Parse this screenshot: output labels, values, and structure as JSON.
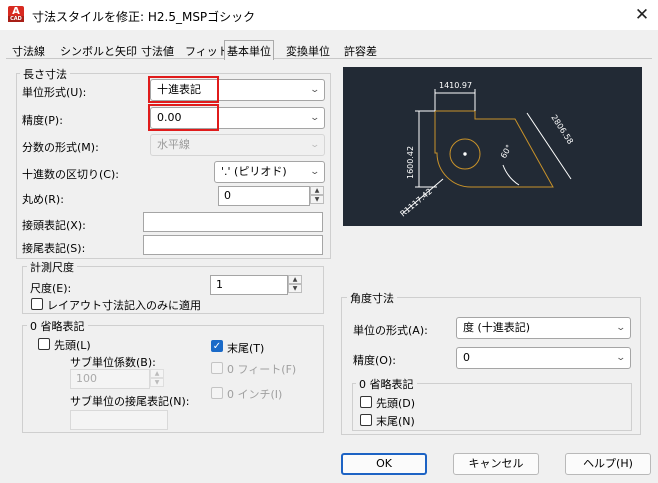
{
  "window": {
    "title": "寸法スタイルを修正: H2.5_MSPゴシック",
    "app_icon_letter": "A",
    "app_icon_sub": "CAD"
  },
  "tabs": [
    "寸法線",
    "シンボルと矢印",
    "寸法値",
    "フィット",
    "基本単位",
    "変換単位",
    "許容差"
  ],
  "active_tab": "基本単位",
  "linear": {
    "group_title": "長さ寸法",
    "unit_format_label": "単位形式(U):",
    "unit_format_value": "十進表記",
    "precision_label": "精度(P):",
    "precision_value": "0.00",
    "fraction_format_label": "分数の形式(M):",
    "fraction_format_value": "水平線",
    "decimal_separator_label": "十進数の区切り(C):",
    "decimal_separator_value": "'.' (ピリオド)",
    "round_off_label": "丸め(R):",
    "round_off_value": "0",
    "prefix_label": "接頭表記(X):",
    "prefix_value": "",
    "suffix_label": "接尾表記(S):",
    "suffix_value": ""
  },
  "scale": {
    "group_title": "計測尺度",
    "factor_label": "尺度(E):",
    "factor_value": "1",
    "layout_only_label": "レイアウト寸法記入のみに適用",
    "layout_only_checked": false
  },
  "zero_suppression_linear": {
    "group_title": "0 省略表記",
    "leading_label": "先頭(L)",
    "leading_checked": false,
    "trailing_label": "末尾(T)",
    "trailing_checked": true,
    "sub_unit_factor_label": "サブ単位係数(B):",
    "sub_unit_factor_value": "100",
    "sub_unit_suffix_label": "サブ単位の接尾表記(N):",
    "sub_unit_suffix_value": "",
    "feet_label": "0 フィート(F)",
    "inches_label": "0 インチ(I)"
  },
  "preview": {
    "dim_top": "1410.97",
    "dim_left": "1600.42",
    "dim_right": "2806.58",
    "dim_angle": "60°",
    "dim_radius": "R1117.42",
    "line_color": "#ffffff",
    "geometry_color": "#c8922a",
    "background": "#222a35"
  },
  "angular": {
    "group_title": "角度寸法",
    "unit_format_label": "単位の形式(A):",
    "unit_format_value": "度 (十進表記)",
    "precision_label": "精度(O):",
    "precision_value": "0",
    "zero_group_title": "0 省略表記",
    "leading_label": "先頭(D)",
    "leading_checked": false,
    "trailing_label": "末尾(N)",
    "trailing_checked": false
  },
  "buttons": {
    "ok": "OK",
    "cancel": "キャンセル",
    "help": "ヘルプ(H)"
  },
  "colors": {
    "highlight": "#e01b1b",
    "accent": "#1d63c4"
  }
}
